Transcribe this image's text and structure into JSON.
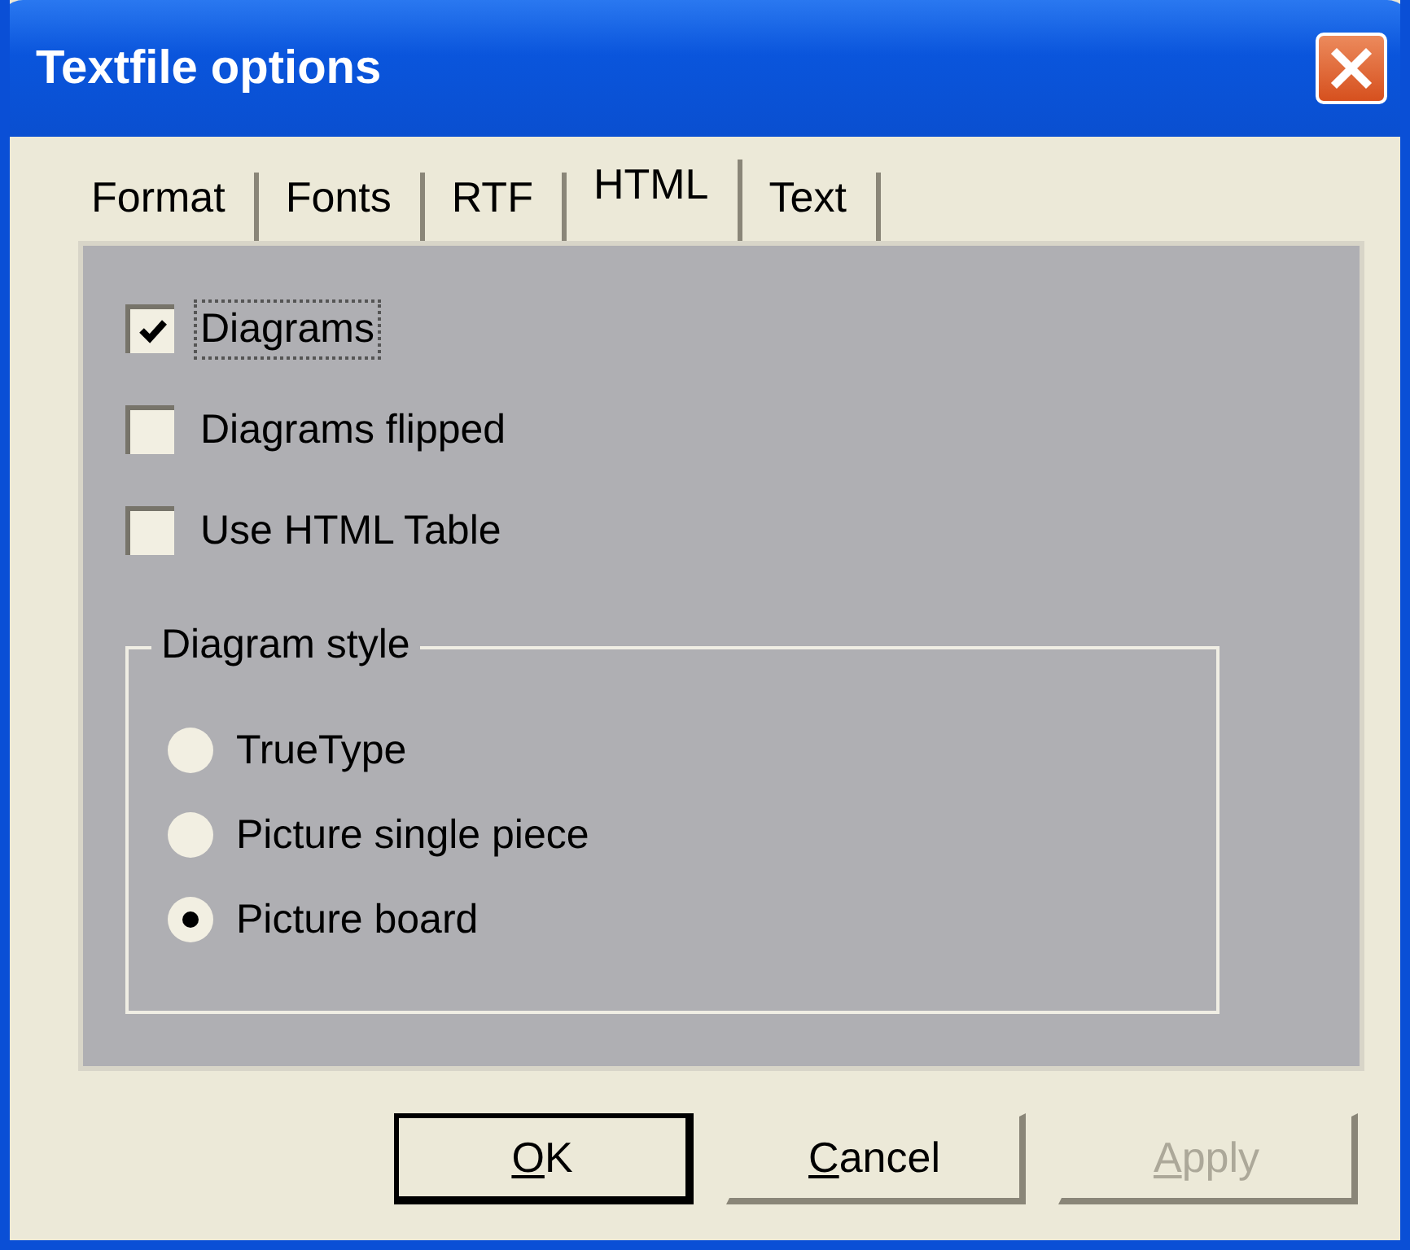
{
  "window": {
    "title": "Textfile options"
  },
  "tabs": [
    {
      "label": "Format",
      "selected": false
    },
    {
      "label": "Fonts",
      "selected": false
    },
    {
      "label": "RTF",
      "selected": false
    },
    {
      "label": "HTML",
      "selected": true
    },
    {
      "label": "Text",
      "selected": false
    }
  ],
  "checkboxes": [
    {
      "label": "Diagrams",
      "checked": true,
      "focused": true
    },
    {
      "label": "Diagrams flipped",
      "checked": false,
      "focused": false
    },
    {
      "label": "Use HTML Table",
      "checked": false,
      "focused": false
    }
  ],
  "group": {
    "title": "Diagram style",
    "options": [
      {
        "label": "TrueType",
        "selected": false
      },
      {
        "label": "Picture single piece",
        "selected": false
      },
      {
        "label": "Picture board",
        "selected": true
      }
    ]
  },
  "buttons": [
    {
      "mnemonic": "O",
      "rest": "K",
      "default": true,
      "disabled": false
    },
    {
      "mnemonic": "C",
      "rest": "ancel",
      "default": false,
      "disabled": false
    },
    {
      "mnemonic": "A",
      "rest": "pply",
      "default": false,
      "disabled": true
    }
  ]
}
